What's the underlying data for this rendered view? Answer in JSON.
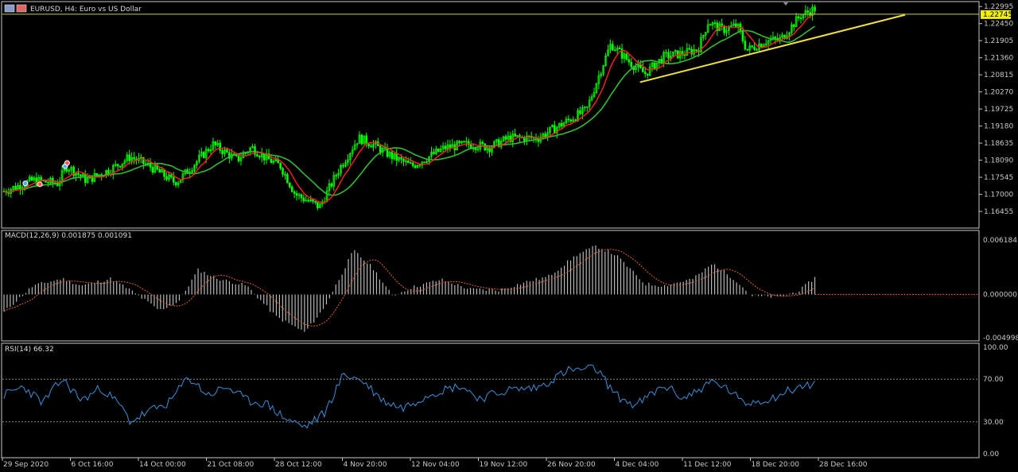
{
  "header": {
    "symbol_title": "EURUSD, H4:  Euro vs US Dollar"
  },
  "colors": {
    "background": "#000000",
    "bull_candle": "#00ff00",
    "bear_candle": "#00ff00",
    "ma_fast": "#ff2020",
    "ma_slow": "#33bb33",
    "trendline": "#f0e040",
    "hline": "#c8d050",
    "macd_hist": "#b8b8b8",
    "macd_signal": "#e06030",
    "rsi_line": "#3a8fd8",
    "grid_frame": "#c8c8c8",
    "price_badge": "#f0f000"
  },
  "chart_data": [
    {
      "name": "price",
      "type": "candlestick",
      "ylim": [
        1.16,
        1.23
      ],
      "price_ticks": [
        "1.22995",
        "1.22450",
        "1.21905",
        "1.21360",
        "1.20815",
        "1.20270",
        "1.19725",
        "1.19180",
        "1.18635",
        "1.18090",
        "1.17545",
        "1.17000",
        "1.16455"
      ],
      "current_price_label": "1.22745",
      "horizontal_line": 1.2275,
      "trendline": {
        "from": [
          0.655,
          1.2058
        ],
        "to": [
          0.928,
          1.2273
        ]
      },
      "key_points": [
        [
          0.0,
          1.171
        ],
        [
          0.03,
          1.1745
        ],
        [
          0.055,
          1.1735
        ],
        [
          0.065,
          1.179
        ],
        [
          0.085,
          1.1745
        ],
        [
          0.11,
          1.178
        ],
        [
          0.13,
          1.182
        ],
        [
          0.15,
          1.179
        ],
        [
          0.175,
          1.174
        ],
        [
          0.18,
          1.1745
        ],
        [
          0.2,
          1.181
        ],
        [
          0.215,
          1.186
        ],
        [
          0.24,
          1.181
        ],
        [
          0.255,
          1.185
        ],
        [
          0.27,
          1.1815
        ],
        [
          0.285,
          1.179
        ],
        [
          0.3,
          1.17
        ],
        [
          0.325,
          1.166
        ],
        [
          0.345,
          1.178
        ],
        [
          0.365,
          1.188
        ],
        [
          0.38,
          1.186
        ],
        [
          0.4,
          1.182
        ],
        [
          0.42,
          1.179
        ],
        [
          0.455,
          1.185
        ],
        [
          0.48,
          1.186
        ],
        [
          0.5,
          1.185
        ],
        [
          0.52,
          1.188
        ],
        [
          0.55,
          1.188
        ],
        [
          0.575,
          1.1925
        ],
        [
          0.6,
          1.197
        ],
        [
          0.615,
          1.21
        ],
        [
          0.625,
          1.218
        ],
        [
          0.645,
          1.212
        ],
        [
          0.66,
          1.2085
        ],
        [
          0.68,
          1.214
        ],
        [
          0.7,
          1.215
        ],
        [
          0.715,
          1.2165
        ],
        [
          0.725,
          1.225
        ],
        [
          0.74,
          1.2225
        ],
        [
          0.755,
          1.224
        ],
        [
          0.765,
          1.216
        ],
        [
          0.785,
          1.219
        ],
        [
          0.8,
          1.2195
        ],
        [
          0.82,
          1.227
        ],
        [
          0.835,
          1.2292
        ]
      ],
      "series": [
        {
          "name": "",
          "kind": "ma_fast"
        },
        {
          "name": "",
          "kind": "ma_slow"
        }
      ]
    },
    {
      "name": "macd",
      "type": "bar",
      "title": "MACD(12,26,9) 0.001875 0.001091",
      "ylim": [
        -0.004998,
        0.006184
      ],
      "ticks": [
        "0.006184",
        "0.000000",
        "-0.004998"
      ],
      "key_points": [
        [
          0.0,
          -0.002
        ],
        [
          0.03,
          0.001
        ],
        [
          0.06,
          0.0018
        ],
        [
          0.08,
          0.001
        ],
        [
          0.11,
          0.0018
        ],
        [
          0.13,
          0.0005
        ],
        [
          0.16,
          -0.0018
        ],
        [
          0.18,
          -0.0008
        ],
        [
          0.2,
          0.0028
        ],
        [
          0.22,
          0.0018
        ],
        [
          0.25,
          0.001
        ],
        [
          0.28,
          -0.0025
        ],
        [
          0.31,
          -0.0043
        ],
        [
          0.33,
          -0.0015
        ],
        [
          0.36,
          0.005
        ],
        [
          0.38,
          0.003
        ],
        [
          0.4,
          -0.0002
        ],
        [
          0.42,
          0.0008
        ],
        [
          0.45,
          0.0017
        ],
        [
          0.48,
          0.0006
        ],
        [
          0.51,
          0.0005
        ],
        [
          0.54,
          0.0015
        ],
        [
          0.56,
          0.002
        ],
        [
          0.59,
          0.0045
        ],
        [
          0.61,
          0.0055
        ],
        [
          0.63,
          0.0045
        ],
        [
          0.66,
          0.0012
        ],
        [
          0.68,
          0.001
        ],
        [
          0.71,
          0.0018
        ],
        [
          0.73,
          0.0035
        ],
        [
          0.755,
          0.0015
        ],
        [
          0.77,
          -0.0002
        ],
        [
          0.8,
          -0.0003
        ],
        [
          0.82,
          0.0005
        ],
        [
          0.835,
          0.0019
        ]
      ],
      "series": [
        {
          "name": "",
          "kind": "histogram"
        },
        {
          "name": "",
          "kind": "signal"
        }
      ]
    },
    {
      "name": "rsi",
      "type": "line",
      "title": "RSI(14) 66.32",
      "ylim": [
        0,
        100
      ],
      "ticks": [
        "100.00",
        "70.00",
        "30.00",
        "0.00"
      ],
      "levels": [
        70,
        30
      ],
      "key_points": [
        [
          0.0,
          55
        ],
        [
          0.02,
          63
        ],
        [
          0.04,
          48
        ],
        [
          0.06,
          70
        ],
        [
          0.08,
          50
        ],
        [
          0.1,
          62
        ],
        [
          0.12,
          45
        ],
        [
          0.13,
          30
        ],
        [
          0.15,
          40
        ],
        [
          0.17,
          48
        ],
        [
          0.19,
          72
        ],
        [
          0.21,
          55
        ],
        [
          0.23,
          63
        ],
        [
          0.25,
          50
        ],
        [
          0.27,
          47
        ],
        [
          0.29,
          33
        ],
        [
          0.31,
          25
        ],
        [
          0.33,
          38
        ],
        [
          0.35,
          75
        ],
        [
          0.37,
          68
        ],
        [
          0.39,
          50
        ],
        [
          0.41,
          43
        ],
        [
          0.44,
          57
        ],
        [
          0.47,
          64
        ],
        [
          0.49,
          52
        ],
        [
          0.52,
          60
        ],
        [
          0.55,
          62
        ],
        [
          0.58,
          78
        ],
        [
          0.61,
          80
        ],
        [
          0.63,
          55
        ],
        [
          0.65,
          45
        ],
        [
          0.68,
          64
        ],
        [
          0.7,
          52
        ],
        [
          0.73,
          68
        ],
        [
          0.75,
          58
        ],
        [
          0.76,
          47
        ],
        [
          0.79,
          52
        ],
        [
          0.81,
          60
        ],
        [
          0.835,
          66
        ]
      ],
      "series": [
        {
          "name": "",
          "kind": "rsi"
        }
      ]
    }
  ],
  "time_axis": {
    "labels": [
      "29 Sep 2020",
      "6 Oct 16:00",
      "14 Oct 00:00",
      "21 Oct 08:00",
      "28 Oct 12:00",
      "4 Nov 20:00",
      "12 Nov 04:00",
      "19 Nov 12:00",
      "26 Nov 20:00",
      "4 Dec 04:00",
      "11 Dec 12:00",
      "18 Dec 20:00",
      "28 Dec 16:00"
    ]
  }
}
